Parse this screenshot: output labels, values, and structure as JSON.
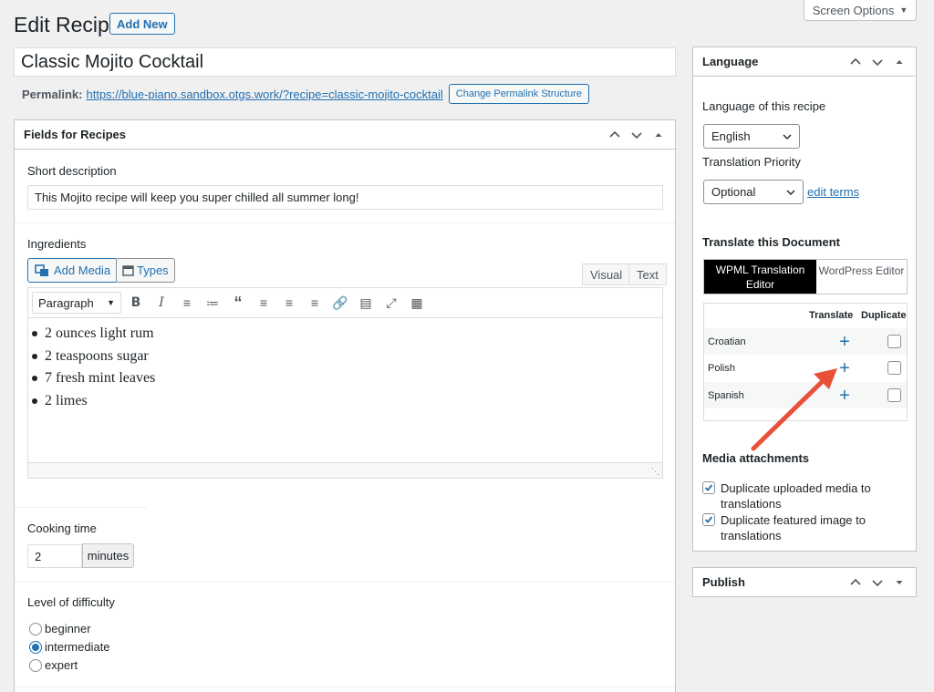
{
  "header": {
    "page_title": "Edit Recipe",
    "add_new": "Add New",
    "screen_options": "Screen Options"
  },
  "post": {
    "title": "Classic Mojito Cocktail",
    "permalink_label": "Permalink:",
    "permalink_url": "https://blue-piano.sandbox.otgs.work/?recipe=classic-mojito-cocktail",
    "change_permalink": "Change Permalink Structure"
  },
  "fields_box": {
    "title": "Fields for Recipes",
    "short_desc_label": "Short description",
    "short_desc_value": "This Mojito recipe will keep you super chilled all summer long!",
    "ingredients_label": "Ingredients",
    "add_media": "Add Media",
    "types": "Types",
    "tab_visual": "Visual",
    "tab_text": "Text",
    "format": "Paragraph",
    "ingredients": [
      "2 ounces light rum",
      "2 teaspoons sugar",
      "7 fresh mint leaves",
      "2 limes"
    ],
    "cooking_label": "Cooking time",
    "cooking_value": "2",
    "cooking_unit": "minutes",
    "difficulty_label": "Level of difficulty",
    "difficulty_options": [
      {
        "label": "beginner",
        "checked": false
      },
      {
        "label": "intermediate",
        "checked": true
      },
      {
        "label": "expert",
        "checked": false
      }
    ]
  },
  "language_box": {
    "title": "Language",
    "lang_label": "Language of this recipe",
    "lang_value": "English",
    "priority_label": "Translation Priority",
    "priority_value": "Optional",
    "edit_terms": "edit terms",
    "translate_title": "Translate this Document",
    "wpml_editor": "WPML Translation Editor",
    "wp_editor": "WordPress Editor",
    "col_translate": "Translate",
    "col_duplicate": "Duplicate",
    "languages": [
      "Croatian",
      "Polish",
      "Spanish"
    ],
    "media_title": "Media attachments",
    "media_opt1": "Duplicate uploaded media to translations",
    "media_opt2": "Duplicate featured image to translations"
  },
  "publish_box": {
    "title": "Publish"
  },
  "colors": {
    "accent": "#2271b1",
    "annotation_arrow": "#e8503a"
  }
}
